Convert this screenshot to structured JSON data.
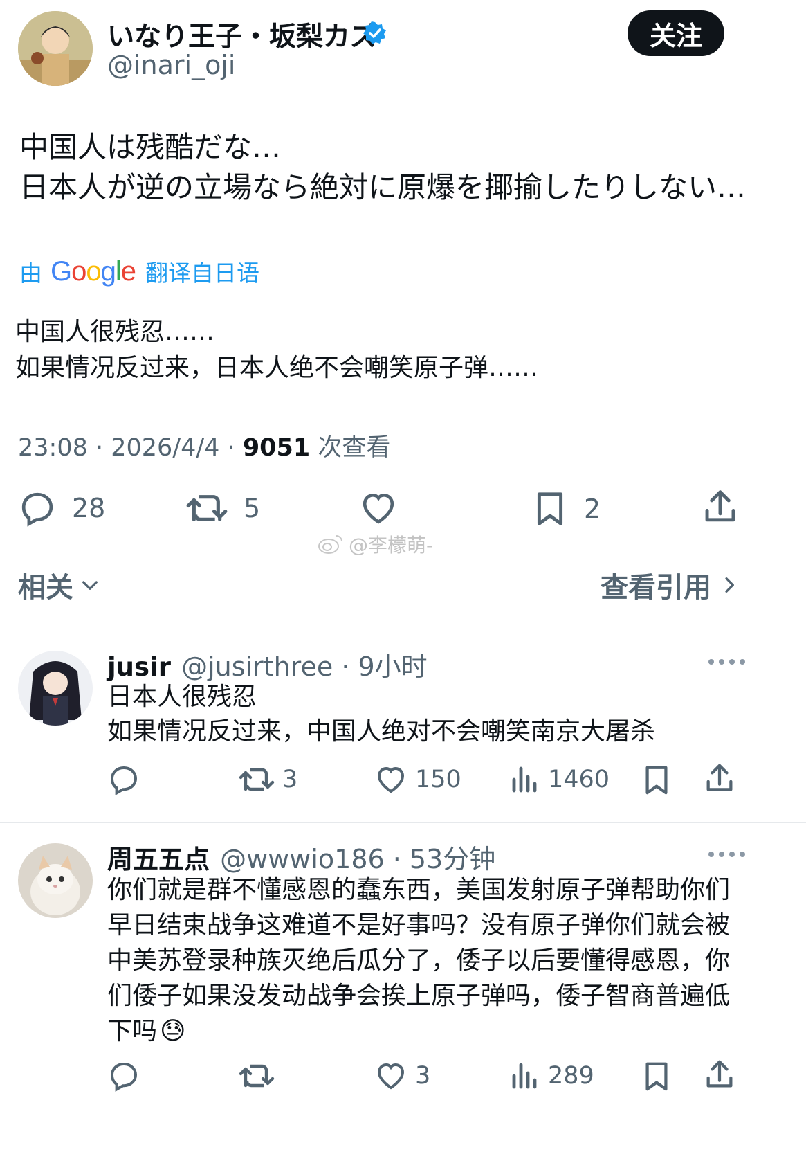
{
  "author": {
    "display_name": "いなり王子・坂梨カズ",
    "handle": "@inari_oji",
    "follow_label": "关注"
  },
  "tweet": {
    "lines": [
      "中国人は残酷だな…",
      "日本人が逆の立場なら絶対に原爆を揶揄したりしない…"
    ],
    "translation_prefix": "由",
    "translation_brand": "Google",
    "translation_suffix": "翻译自日语",
    "translated_lines": [
      "中国人很残忍……",
      "如果情况反过来，日本人绝不会嘲笑原子弹……"
    ],
    "timestamp": "23:08 · 2026/4/4 · ",
    "views": "9051",
    "views_label": " 次查看",
    "stats": {
      "replies": "28",
      "retweets": "5",
      "bookmarks": "2"
    }
  },
  "watermark": "@李檬萌-",
  "related": {
    "label": "相关",
    "quotes_label": "查看引用"
  },
  "replies": [
    {
      "name": "jusir",
      "handle": "@jusirthree",
      "time": " · 9小时",
      "lines": [
        "日本人很残忍",
        "如果情况反过来，中国人绝对不会嘲笑南京大屠杀"
      ],
      "retweets": "3",
      "likes": "150",
      "views": "1460"
    },
    {
      "name": "周五五点",
      "handle": "@wwwio186",
      "time": " · 53分钟",
      "text": "你们就是群不懂感恩的蠢东西，美国发射原子弹帮助你们早日结束战争这难道不是好事吗？没有原子弹你们就会被中美苏登录种族灭绝后瓜分了，倭子以后要懂得感恩，你们倭子如果没发动战争会挨上原子弹吗，倭子智商普遍低下吗",
      "emoji": "😓",
      "likes": "3",
      "views": "289"
    }
  ],
  "colors": {
    "text": "#0f1419",
    "secondary": "#536471",
    "link": "#1d9bf0",
    "verified": "#1d9bf0"
  }
}
